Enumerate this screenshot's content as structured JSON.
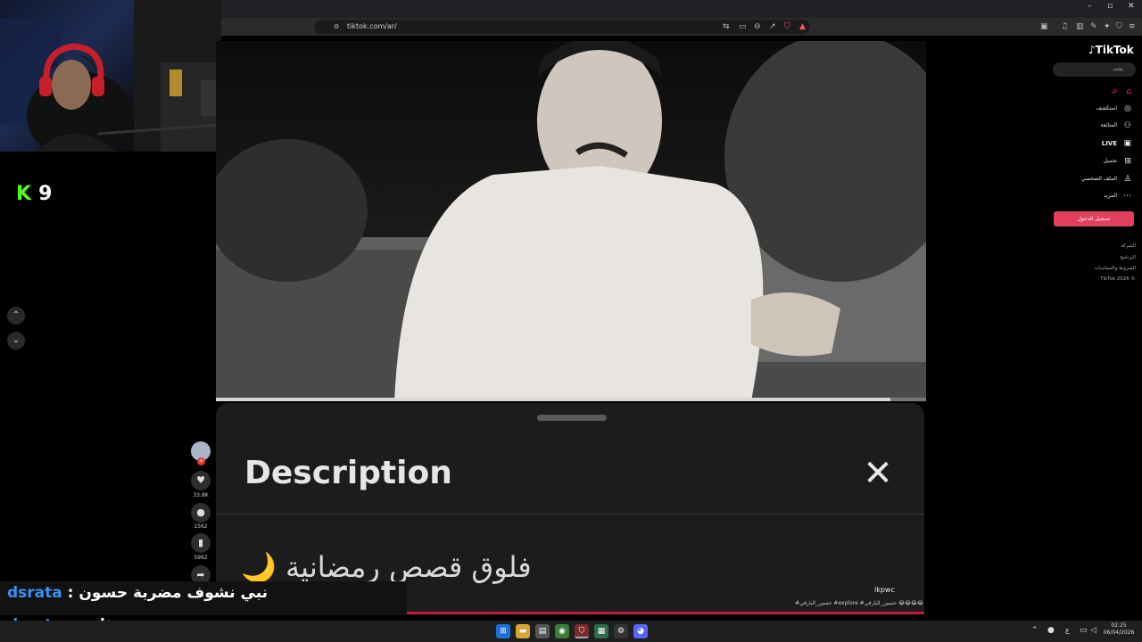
{
  "browser": {
    "url": "tiktok.com/ar/"
  },
  "stream": {
    "kick_badge": "K",
    "viewer_count": "9"
  },
  "video": {
    "progress_fraction": 0.95
  },
  "description_sheet": {
    "title": "Description",
    "close_symbol": "✕",
    "text": "فلوق قصص رمضانية 🌙",
    "username": "lkpwc",
    "hashtags": "#حسين_البارقي #explore #حسين_البارقي 😂😂😂😂"
  },
  "action_rail": {
    "likes": "33.8K",
    "comments": "1562",
    "saves": "5962"
  },
  "chat": [
    {
      "user": "dsrata",
      "message": "نبي نشوف مضربة حسون"
    },
    {
      "user": "dsrata",
      "message": "مره ثانية"
    }
  ],
  "tiktok_panel": {
    "logo": "TikTok",
    "search_placeholder": "بحث",
    "nav": [
      {
        "label": "لك",
        "icon": "home-icon"
      },
      {
        "label": "استكشف",
        "icon": "compass-icon"
      },
      {
        "label": "المتابَعة",
        "icon": "following-icon"
      },
      {
        "label": "LIVE",
        "icon": "live-icon"
      },
      {
        "label": "تحميل",
        "icon": "upload-icon"
      },
      {
        "label": "الملف الشخصي",
        "icon": "profile-icon"
      },
      {
        "label": "المزيد",
        "icon": "more-icon"
      }
    ],
    "login_button": "تسجيل الدخول",
    "footer": [
      "الشركة",
      "البرنامج",
      "الشروط والسياسات",
      "TikTok 2026 ©"
    ]
  },
  "taskbar": {
    "time": "02:25",
    "date": "06/04/2026"
  },
  "colors": {
    "kick_green": "#53fc18",
    "chat_user_blue": "#3d8ff0",
    "tiktok_red": "#e0405d"
  }
}
